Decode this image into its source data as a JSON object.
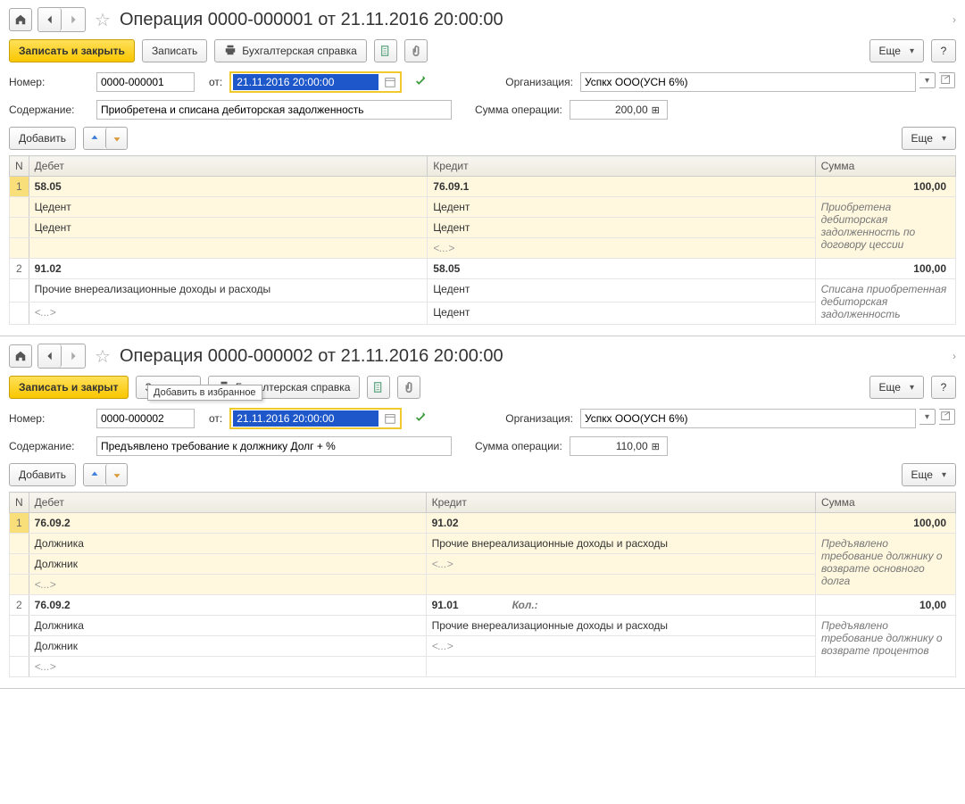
{
  "windows": [
    {
      "title": "Операция 0000-000001 от 21.11.2016 20:00:00",
      "tooltip": null,
      "toolbar": {
        "save_close": "Записать и закрыть",
        "save": "Записать",
        "print": "Бухгалтерская справка",
        "more": "Еще",
        "help": "?"
      },
      "star_tooltip": "Добавить в избранное",
      "fields": {
        "number_label": "Номер:",
        "number": "0000-000001",
        "from_label": "от:",
        "date": "21.11.2016 20:00:00",
        "org_label": "Организация:",
        "org": "Успкх ООО(УСН 6%)",
        "content_label": "Содержание:",
        "content": "Приобретена и списана дебиторская задолженность",
        "sum_label": "Сумма операции:",
        "sum": "200,00"
      },
      "subtoolbar": {
        "add": "Добавить",
        "more": "Еще"
      },
      "table": {
        "headers": {
          "n": "N",
          "debet": "Дебет",
          "kredit": "Кредит",
          "sum": "Сумма"
        },
        "rows": [
          {
            "n": "1",
            "hl": true,
            "debet": [
              "58.05",
              "Цедент",
              "Цедент"
            ],
            "kredit": [
              "76.09.1",
              "Цедент",
              "Цедент",
              "<...>"
            ],
            "sum": "100,00",
            "note": "Приобретена дебиторская задолженность по договору цессии"
          },
          {
            "n": "2",
            "hl": false,
            "debet": [
              "91.02",
              "Прочие внереализационные доходы и расходы",
              "<...>"
            ],
            "kredit": [
              "58.05",
              "Цедент",
              "Цедент"
            ],
            "sum": "100,00",
            "note": "Списана приобретенная дебиторская задолженность"
          }
        ]
      }
    },
    {
      "title": "Операция 0000-000002 от 21.11.2016 20:00:00",
      "tooltip": "Добавить в избранное",
      "toolbar": {
        "save_close": "Записать и закрыт",
        "save": "Записать",
        "print": "Бухгалтерская справка",
        "more": "Еще",
        "help": "?"
      },
      "fields": {
        "number_label": "Номер:",
        "number": "0000-000002",
        "from_label": "от:",
        "date": "21.11.2016 20:00:00",
        "org_label": "Организация:",
        "org": "Успкх ООО(УСН 6%)",
        "content_label": "Содержание:",
        "content": "Предъявлено требование к должнику Долг + %",
        "sum_label": "Сумма операции:",
        "sum": "110,00"
      },
      "subtoolbar": {
        "add": "Добавить",
        "more": "Еще"
      },
      "table": {
        "headers": {
          "n": "N",
          "debet": "Дебет",
          "kredit": "Кредит",
          "sum": "Сумма"
        },
        "kol_label": "Кол.:",
        "rows": [
          {
            "n": "1",
            "hl": true,
            "debet": [
              "76.09.2",
              "Должника",
              "Должник",
              "<...>"
            ],
            "kredit": [
              "91.02",
              "Прочие внереализационные доходы и расходы",
              "<...>"
            ],
            "sum": "100,00",
            "note": "Предъявлено требование должнику о возврате основного долга"
          },
          {
            "n": "2",
            "hl": false,
            "debet": [
              "76.09.2",
              "Должника",
              "Должник",
              "<...>"
            ],
            "kredit": [
              "91.01",
              "Прочие внереализационные доходы и расходы",
              "<...>"
            ],
            "kol": "Кол.:",
            "sum": "10,00",
            "note": "Предъявлено требование должнику о возврате процентов"
          }
        ]
      }
    }
  ]
}
